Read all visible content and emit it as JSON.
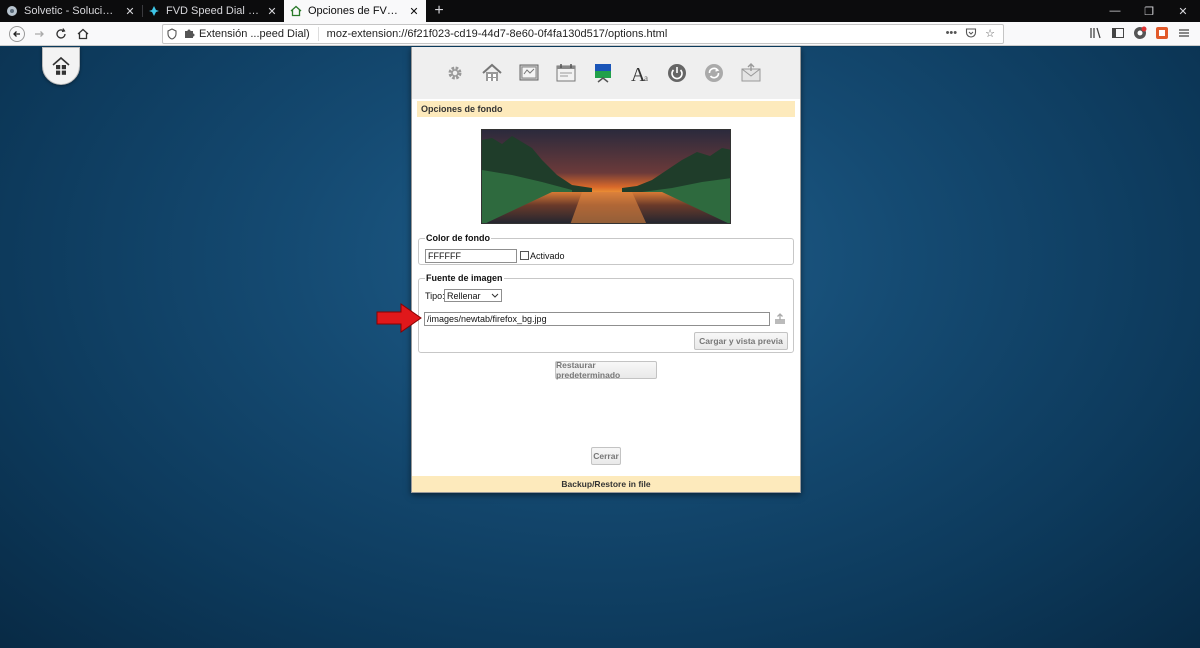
{
  "browser": {
    "tabs": [
      {
        "title": "Solvetic - Solución a los proble",
        "active": false
      },
      {
        "title": "FVD Speed Dial with Full Onlin",
        "active": false
      },
      {
        "title": "Opciones de FVD SpeedDial",
        "active": true
      }
    ],
    "new_tab_glyph": "+",
    "urlbar": {
      "extension_label": "Extensión ...peed Dial)",
      "url": "moz-extension://6f21f023-cd19-44d7-8e60-0f4fa130d517/options.html",
      "more": "•••"
    }
  },
  "dialog": {
    "toolbar_icons": [
      "gear-icon",
      "home-icon",
      "display-icon",
      "calendar-icon",
      "background-icon",
      "font-icon",
      "power-icon",
      "sync-icon",
      "mail-icon"
    ],
    "section_title": "Opciones de fondo",
    "color": {
      "legend": "Color de fondo",
      "value": "FFFFFF",
      "activated_label": "Activado"
    },
    "source": {
      "legend": "Fuente de imagen",
      "type_label": "Tipo:",
      "type_value": "Rellenar",
      "path": "/images/newtab/firefox_bg.jpg",
      "load_button": "Cargar y vista previa"
    },
    "restore_button": "Restaurar predeterminado",
    "close_button": "Cerrar",
    "footer": "Backup/Restore in file"
  },
  "colors": {
    "accent_bar": "#fdeabc",
    "arrow": "#e0181b"
  }
}
